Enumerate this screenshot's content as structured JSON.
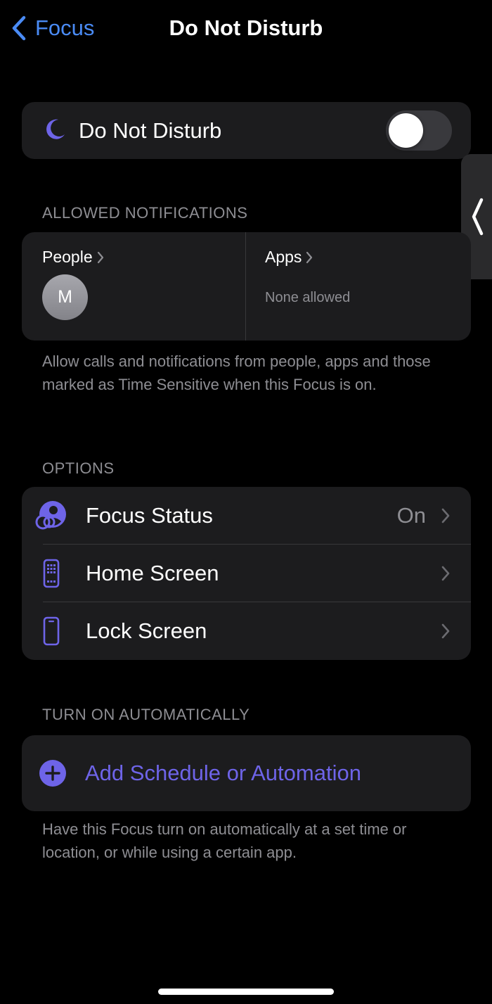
{
  "nav": {
    "back_label": "Focus",
    "title": "Do Not Disturb"
  },
  "dnd": {
    "icon": "moon-icon",
    "label": "Do Not Disturb",
    "toggle_on": false
  },
  "allowed_notifications": {
    "header": "ALLOWED NOTIFICATIONS",
    "people": {
      "title": "People",
      "avatar_initial": "M"
    },
    "apps": {
      "title": "Apps",
      "status": "None allowed"
    },
    "footer": "Allow calls and notifications from people, apps and those marked as Time Sensitive when this Focus is on."
  },
  "options": {
    "header": "OPTIONS",
    "items": [
      {
        "icon": "focus-status-icon",
        "label": "Focus Status",
        "value": "On"
      },
      {
        "icon": "home-screen-icon",
        "label": "Home Screen",
        "value": ""
      },
      {
        "icon": "lock-screen-icon",
        "label": "Lock Screen",
        "value": ""
      }
    ]
  },
  "automation": {
    "header": "TURN ON AUTOMATICALLY",
    "add_label": "Add Schedule or Automation",
    "footer": "Have this Focus turn on automatically at a set time or location, or while using a certain app."
  },
  "colors": {
    "background": "#000000",
    "card": "#1c1c1e",
    "accent_blue": "#4a8bf5",
    "accent_purple": "#6e64e8",
    "secondary_text": "#8e8e93"
  }
}
